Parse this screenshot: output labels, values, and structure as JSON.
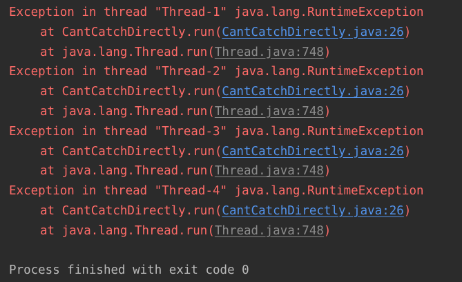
{
  "console": {
    "blocks": [
      {
        "exception": "Exception in thread \"Thread-1\" java.lang.RuntimeException",
        "frame1_prefix": "at CantCatchDirectly.run(",
        "frame1_link": "CantCatchDirectly.java:26",
        "frame1_suffix": ")",
        "frame2_prefix": "at java.lang.Thread.run(",
        "frame2_link": "Thread.java:748",
        "frame2_suffix": ")"
      },
      {
        "exception": "Exception in thread \"Thread-2\" java.lang.RuntimeException",
        "frame1_prefix": "at CantCatchDirectly.run(",
        "frame1_link": "CantCatchDirectly.java:26",
        "frame1_suffix": ")",
        "frame2_prefix": "at java.lang.Thread.run(",
        "frame2_link": "Thread.java:748",
        "frame2_suffix": ")"
      },
      {
        "exception": "Exception in thread \"Thread-3\" java.lang.RuntimeException",
        "frame1_prefix": "at CantCatchDirectly.run(",
        "frame1_link": "CantCatchDirectly.java:26",
        "frame1_suffix": ")",
        "frame2_prefix": "at java.lang.Thread.run(",
        "frame2_link": "Thread.java:748",
        "frame2_suffix": ")"
      },
      {
        "exception": "Exception in thread \"Thread-4\" java.lang.RuntimeException",
        "frame1_prefix": "at CantCatchDirectly.run(",
        "frame1_link": "CantCatchDirectly.java:26",
        "frame1_suffix": ")",
        "frame2_prefix": "at java.lang.Thread.run(",
        "frame2_link": "Thread.java:748",
        "frame2_suffix": ")"
      }
    ],
    "finish_message": "Process finished with exit code 0"
  },
  "colors": {
    "background": "#2b2b2b",
    "error_text": "#ff6b68",
    "source_link": "#5394ec",
    "library_link": "#8c8c8c",
    "normal_text": "#bbbbbb"
  }
}
